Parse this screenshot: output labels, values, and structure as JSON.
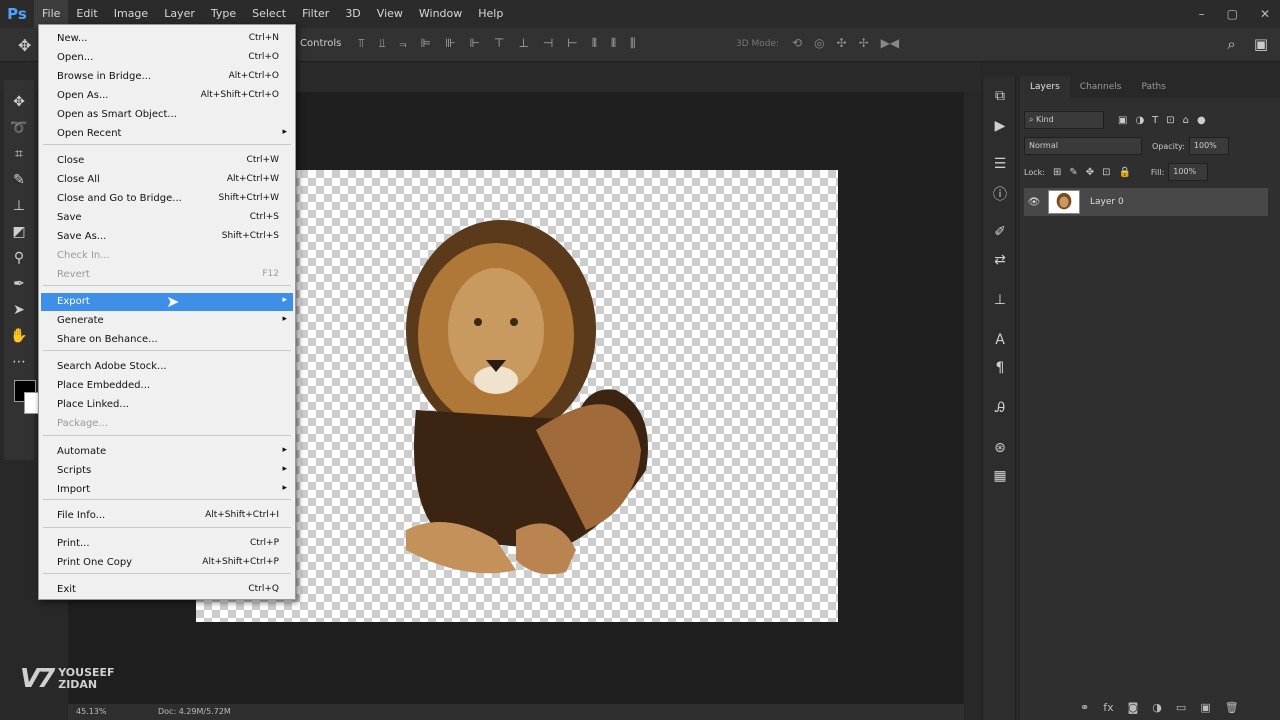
{
  "app": {
    "logo": "Ps"
  },
  "menubar": {
    "items": [
      "File",
      "Edit",
      "Image",
      "Layer",
      "Type",
      "Select",
      "Filter",
      "3D",
      "View",
      "Window",
      "Help"
    ],
    "window_controls": [
      "–",
      "▢",
      "✕"
    ]
  },
  "optionsbar": {
    "controls_label": "Controls",
    "mode_3d_label": "3D Mode:",
    "align_icons": [
      "⫪",
      "⫫",
      "⫬",
      "⊫",
      "⊪",
      "⊩",
      "⊤",
      "⊥",
      "⊣",
      "⊢",
      "⦀",
      "⫴",
      "⫼"
    ]
  },
  "file_menu": {
    "items": [
      {
        "label": "New...",
        "shortcut": "Ctrl+N"
      },
      {
        "label": "Open...",
        "shortcut": "Ctrl+O"
      },
      {
        "label": "Browse in Bridge...",
        "shortcut": "Alt+Ctrl+O"
      },
      {
        "label": "Open As...",
        "shortcut": "Alt+Shift+Ctrl+O"
      },
      {
        "label": "Open as Smart Object...",
        "shortcut": ""
      },
      {
        "label": "Open Recent",
        "shortcut": "",
        "submenu": true
      },
      {
        "label": "Close",
        "shortcut": "Ctrl+W"
      },
      {
        "label": "Close All",
        "shortcut": "Alt+Ctrl+W"
      },
      {
        "label": "Close and Go to Bridge...",
        "shortcut": "Shift+Ctrl+W"
      },
      {
        "label": "Save",
        "shortcut": "Ctrl+S"
      },
      {
        "label": "Save As...",
        "shortcut": "Shift+Ctrl+S"
      },
      {
        "label": "Check In...",
        "shortcut": "",
        "disabled": true
      },
      {
        "label": "Revert",
        "shortcut": "F12",
        "disabled": true
      },
      {
        "label": "Export",
        "shortcut": "",
        "submenu": true,
        "highlight": true
      },
      {
        "label": "Generate",
        "shortcut": "",
        "submenu": true
      },
      {
        "label": "Share on Behance...",
        "shortcut": ""
      },
      {
        "label": "Search Adobe Stock...",
        "shortcut": ""
      },
      {
        "label": "Place Embedded...",
        "shortcut": ""
      },
      {
        "label": "Place Linked...",
        "shortcut": ""
      },
      {
        "label": "Package...",
        "shortcut": "",
        "disabled": true
      },
      {
        "label": "Automate",
        "shortcut": "",
        "submenu": true
      },
      {
        "label": "Scripts",
        "shortcut": "",
        "submenu": true
      },
      {
        "label": "Import",
        "shortcut": "",
        "submenu": true
      },
      {
        "label": "File Info...",
        "shortcut": "Alt+Shift+Ctrl+I"
      },
      {
        "label": "Print...",
        "shortcut": "Ctrl+P"
      },
      {
        "label": "Print One Copy",
        "shortcut": "Alt+Shift+Ctrl+P"
      },
      {
        "label": "Exit",
        "shortcut": "Ctrl+Q"
      }
    ]
  },
  "statusbar": {
    "zoom": "45.13%",
    "doc": "Doc: 4.29M/5.72M"
  },
  "watermark": {
    "mark": "V7",
    "line1": "YOUSEEF",
    "line2": "ZIDAN"
  },
  "layers_panel": {
    "tabs": [
      "Layers",
      "Channels",
      "Paths"
    ],
    "filter_kind": "Kind",
    "blend_mode": "Normal",
    "opacity_label": "Opacity:",
    "opacity_value": "100%",
    "lock_label": "Lock:",
    "fill_label": "Fill:",
    "fill_value": "100%",
    "layer_name": "Layer 0",
    "footer_icons": [
      "fx",
      "◙",
      "◑",
      "▭",
      "▣",
      "🗑"
    ]
  }
}
